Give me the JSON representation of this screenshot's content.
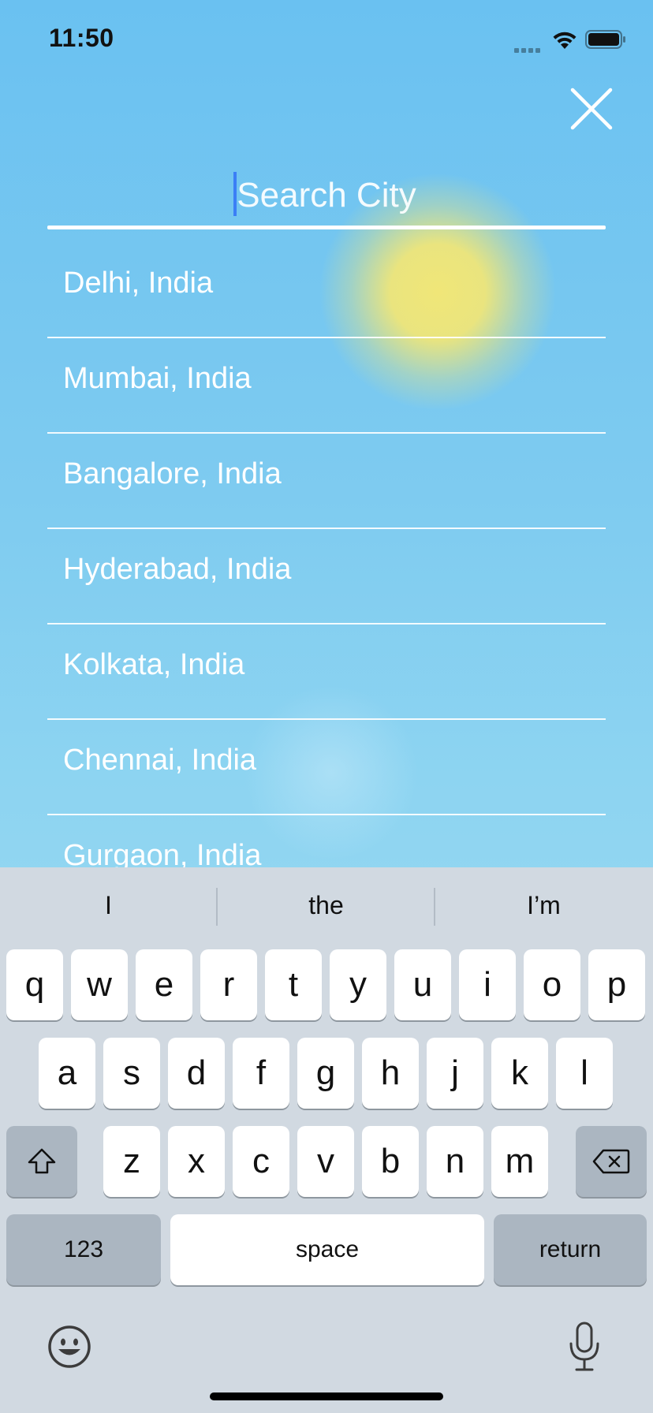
{
  "status_bar": {
    "time": "11:50"
  },
  "search": {
    "placeholder": "Search City",
    "value": ""
  },
  "cities": [
    "Delhi, India",
    "Mumbai, India",
    "Bangalore, India",
    "Hyderabad, India",
    "Kolkata, India",
    "Chennai, India",
    "Gurgaon, India"
  ],
  "keyboard": {
    "suggestions": [
      "I",
      "the",
      "I’m"
    ],
    "row1": [
      "q",
      "w",
      "e",
      "r",
      "t",
      "y",
      "u",
      "i",
      "o",
      "p"
    ],
    "row2": [
      "a",
      "s",
      "d",
      "f",
      "g",
      "h",
      "j",
      "k",
      "l"
    ],
    "row3": [
      "z",
      "x",
      "c",
      "v",
      "b",
      "n",
      "m"
    ],
    "numbers_label": "123",
    "space_label": "space",
    "return_label": "return"
  },
  "icons": {
    "close": "close-icon",
    "shift": "shift-icon",
    "delete": "backspace-icon",
    "emoji": "emoji-icon",
    "mic": "microphone-icon",
    "wifi": "wifi-icon",
    "battery": "battery-icon"
  },
  "colors": {
    "sky_top": "#6ac1f1",
    "sky_bottom": "#a8def3",
    "sun": "#f0e678",
    "keyboard_bg": "#d1d9e1",
    "caret": "#3b7ff6"
  }
}
